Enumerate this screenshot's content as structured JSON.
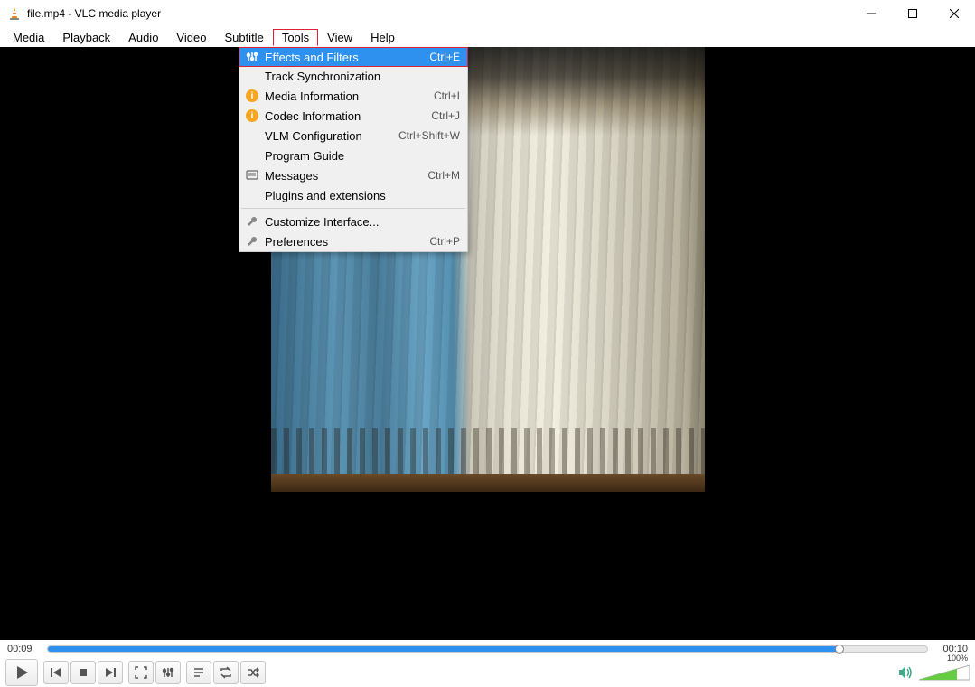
{
  "window": {
    "title": "file.mp4 - VLC media player"
  },
  "menubar": [
    "Media",
    "Playback",
    "Audio",
    "Video",
    "Subtitle",
    "Tools",
    "View",
    "Help"
  ],
  "active_menu_index": 5,
  "tools_menu": {
    "items": [
      {
        "icon": "sliders",
        "label": "Effects and Filters",
        "shortcut": "Ctrl+E",
        "highlighted": true
      },
      {
        "icon": "",
        "label": "Track Synchronization",
        "shortcut": ""
      },
      {
        "icon": "info",
        "label": "Media Information",
        "shortcut": "Ctrl+I"
      },
      {
        "icon": "info",
        "label": "Codec Information",
        "shortcut": "Ctrl+J"
      },
      {
        "icon": "",
        "label": "VLM Configuration",
        "shortcut": "Ctrl+Shift+W"
      },
      {
        "icon": "",
        "label": "Program Guide",
        "shortcut": ""
      },
      {
        "icon": "messages",
        "label": "Messages",
        "shortcut": "Ctrl+M"
      },
      {
        "icon": "",
        "label": "Plugins and extensions",
        "shortcut": ""
      },
      {
        "sep": true
      },
      {
        "icon": "wrench",
        "label": "Customize Interface...",
        "shortcut": ""
      },
      {
        "icon": "wrench",
        "label": "Preferences",
        "shortcut": "Ctrl+P"
      }
    ]
  },
  "playback": {
    "current_time": "00:09",
    "total_time": "00:10",
    "progress_percent": 90
  },
  "volume": {
    "percent_label": "100%"
  }
}
